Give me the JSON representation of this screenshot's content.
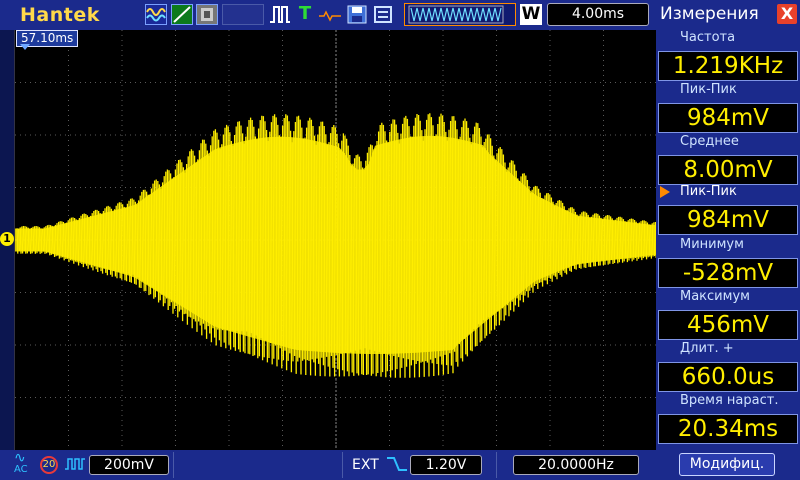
{
  "header": {
    "brand": "Hantek",
    "timebase": "4.00ms",
    "acq_mode": "W",
    "icons": [
      "waveform-mode-icon",
      "line-mode-icon",
      "persist-icon",
      "pulse-icon",
      "trigger-t-icon",
      "ref-icon",
      "save-icon",
      "disk-icon",
      "trigger-position-bar"
    ]
  },
  "screen": {
    "trigger_offset": "57.10ms",
    "channel_marker": "1",
    "trace_color": "#ffee00"
  },
  "footer": {
    "coupling": "AC",
    "bw_limit": "20",
    "ch_scale": "200mV",
    "trigger_source": "EXT",
    "trigger_level": "1.20V",
    "frequency": "20.0000Hz"
  },
  "panel": {
    "title": "Измерения",
    "close": "X",
    "modify_button": "Модифиц.",
    "measurements": [
      {
        "label": "Частота",
        "value": "1.219KHz",
        "active": false
      },
      {
        "label": "Пик-Пик",
        "value": "984mV",
        "active": false
      },
      {
        "label": "Среднее",
        "value": "8.00mV",
        "active": false
      },
      {
        "label": "Пик-Пик",
        "value": "984mV",
        "active": true
      },
      {
        "label": "Минимум",
        "value": "-528mV",
        "active": false
      },
      {
        "label": "Максимум",
        "value": "456mV",
        "active": false
      },
      {
        "label": "Длит.  +",
        "value": "660.0us",
        "active": false
      },
      {
        "label": "Время  нараст.",
        "value": "20.34ms",
        "active": false
      }
    ]
  },
  "colors": {
    "bar": "#1b2a8c",
    "trace": "#ffee00",
    "accent": "#ff8a00",
    "grid": "#5a5a5a"
  }
}
